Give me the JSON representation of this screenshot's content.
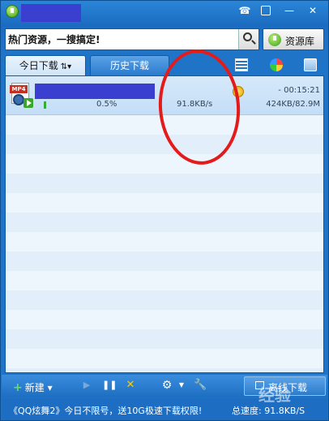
{
  "window": {
    "title": "",
    "buttons": [
      "chat-icon",
      "menu-icon",
      "minimize-icon",
      "close-icon"
    ]
  },
  "search": {
    "value": "热门资源，一搜搞定!",
    "resource_button": "资源库"
  },
  "tabs": [
    {
      "label": "今日下载",
      "active": true
    },
    {
      "label": "历史下载",
      "active": false
    }
  ],
  "downloads": [
    {
      "file_type": "MP4",
      "name": "",
      "progress_text": "0.5%",
      "progress": 0.005,
      "speed": "91.8KB/s",
      "time_left": "- 00:15:21",
      "size": "424KB/82.9M"
    }
  ],
  "toolbar": {
    "new_label": "新建",
    "offline_label": "离线下载"
  },
  "status": {
    "promo": "《QQ炫舞2》今日不限号，送10G极速下载权限!",
    "total_speed": "总速度: 91.8KB/S"
  },
  "watermark": "经验",
  "colors": {
    "frame": "#1f74c8",
    "accent_green": "#2fb12f",
    "annotation_red": "#e41b1b",
    "redaction": "#3a3fd0"
  }
}
